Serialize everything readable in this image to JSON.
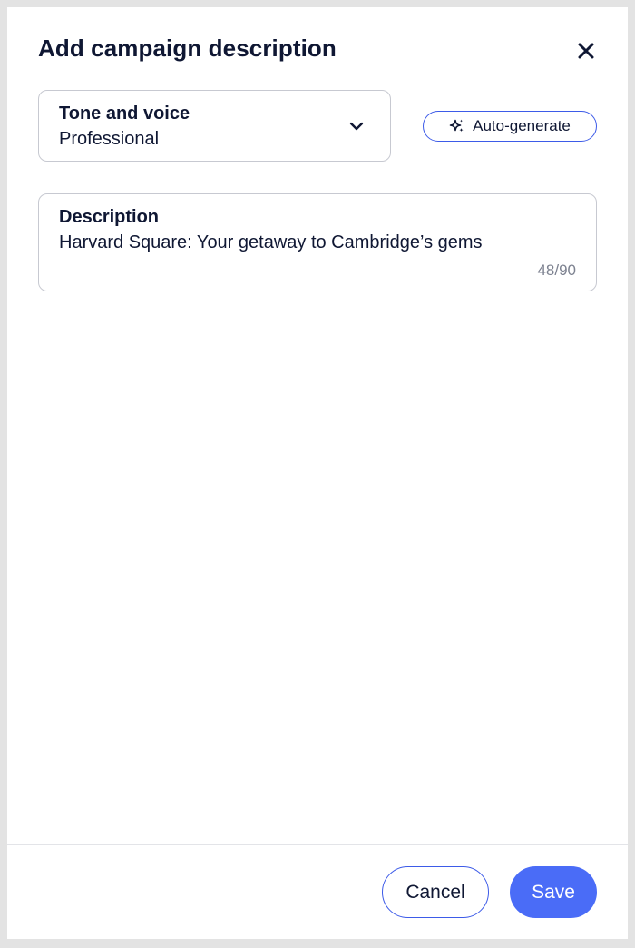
{
  "dialog": {
    "title": "Add campaign description",
    "close_icon": "close-icon"
  },
  "tone_select": {
    "label": "Tone and voice",
    "value": "Professional",
    "icon": "chevron-down-icon"
  },
  "auto_generate": {
    "label": "Auto-generate",
    "icon": "sparkle-icon",
    "accent_color": "#3d5be8"
  },
  "description": {
    "label": "Description",
    "value": "Harvard Square: Your getaway to Cambridge’s gems",
    "counter": "48/90"
  },
  "footer": {
    "cancel_label": "Cancel",
    "save_label": "Save",
    "primary_color": "#4a6cf7"
  }
}
